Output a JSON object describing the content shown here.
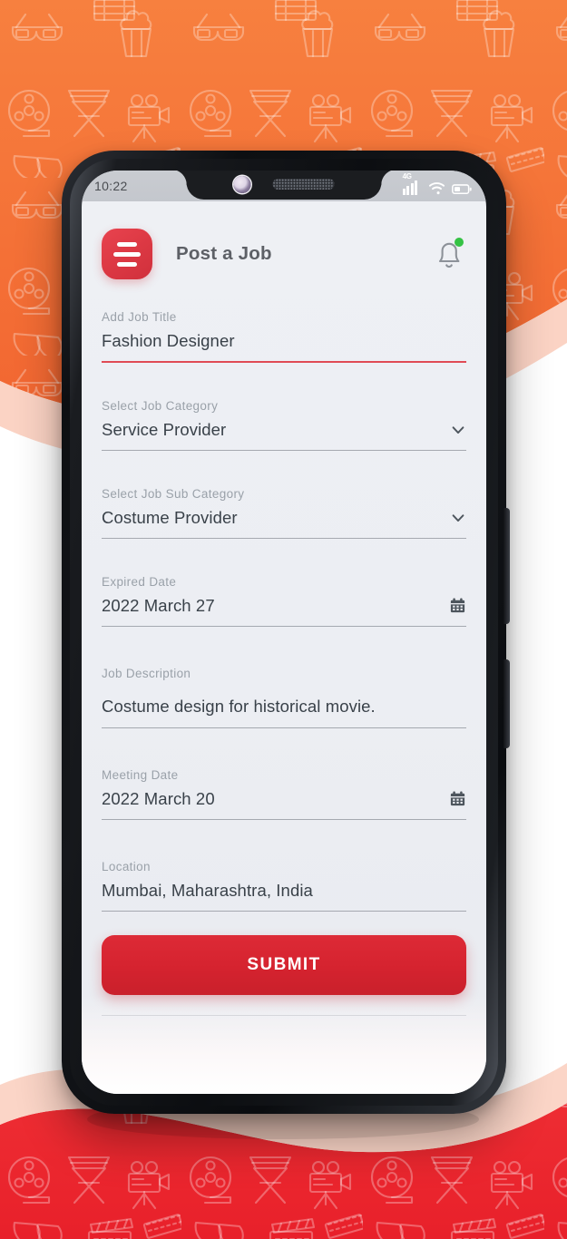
{
  "background": {
    "top_color": "#f4703a",
    "bottom_color": "#ed2a30",
    "swoosh_color": "#fbd3c4",
    "mid_color": "#ffffff",
    "pattern_icons": [
      "3d-glasses-icon",
      "popcorn-icon",
      "film-reel-icon",
      "director-chair-icon",
      "movie-camera-icon",
      "theater-masks-icon",
      "clapperboard-icon",
      "film-strip-icon",
      "ticket-icon"
    ]
  },
  "device": {
    "frame_color": "#121418",
    "screen_bg": "#eceef3",
    "notch": {
      "camera": "front-camera",
      "speaker": "earpiece-speaker"
    }
  },
  "status_bar": {
    "time": "10:22",
    "network_label": "4G",
    "icons": [
      "signal-bars-icon",
      "wifi-icon",
      "battery-icon"
    ],
    "signal_bars": 5,
    "battery_level": "low"
  },
  "header": {
    "menu_icon": "hamburger-menu-icon",
    "title": "Post a Job",
    "bell_icon": "notification-bell-icon",
    "bell_badge": true,
    "badge_color": "#35c244",
    "menu_color": "#dd3944"
  },
  "form": {
    "fields": [
      {
        "key": "job_title",
        "label": "Add Job  Title",
        "value": "Fashion Designer",
        "type": "text",
        "placeholder": "Add Job Title",
        "accent_underline": true,
        "trailing_icon": null
      },
      {
        "key": "job_category",
        "label": "Select  Job  Category",
        "value": "Service Provider",
        "type": "select",
        "placeholder": "Select Job Category",
        "accent_underline": false,
        "trailing_icon": "chevron-down-icon"
      },
      {
        "key": "job_sub_category",
        "label": "Select  Job  Sub Category",
        "value": "Costume Provider",
        "type": "select",
        "placeholder": "Select Job Sub Category",
        "accent_underline": false,
        "trailing_icon": "chevron-down-icon"
      },
      {
        "key": "expired_date",
        "label": "Expired Date",
        "value": "2022 March 27",
        "type": "date",
        "placeholder": "Expired Date",
        "accent_underline": false,
        "trailing_icon": "calendar-icon"
      },
      {
        "key": "job_description",
        "label": "Job Description",
        "value": "Costume design for historical movie.",
        "type": "textarea",
        "placeholder": "Job Description",
        "accent_underline": false,
        "trailing_icon": null
      },
      {
        "key": "meeting_date",
        "label": "Meeting Date",
        "value": "2022 March 20",
        "type": "date",
        "placeholder": "Meeting Date",
        "accent_underline": false,
        "trailing_icon": "calendar-icon"
      },
      {
        "key": "location",
        "label": "Location",
        "value": "Mumbai, Maharashtra, India",
        "type": "text",
        "placeholder": "Location",
        "accent_underline": false,
        "trailing_icon": null
      }
    ]
  },
  "submit": {
    "label": "SUBMIT",
    "color": "#d5232f"
  },
  "colors": {
    "label_text": "#9aa1a9",
    "value_text": "#394149",
    "accent_red": "#e04b55",
    "title_text": "#5d6066"
  }
}
